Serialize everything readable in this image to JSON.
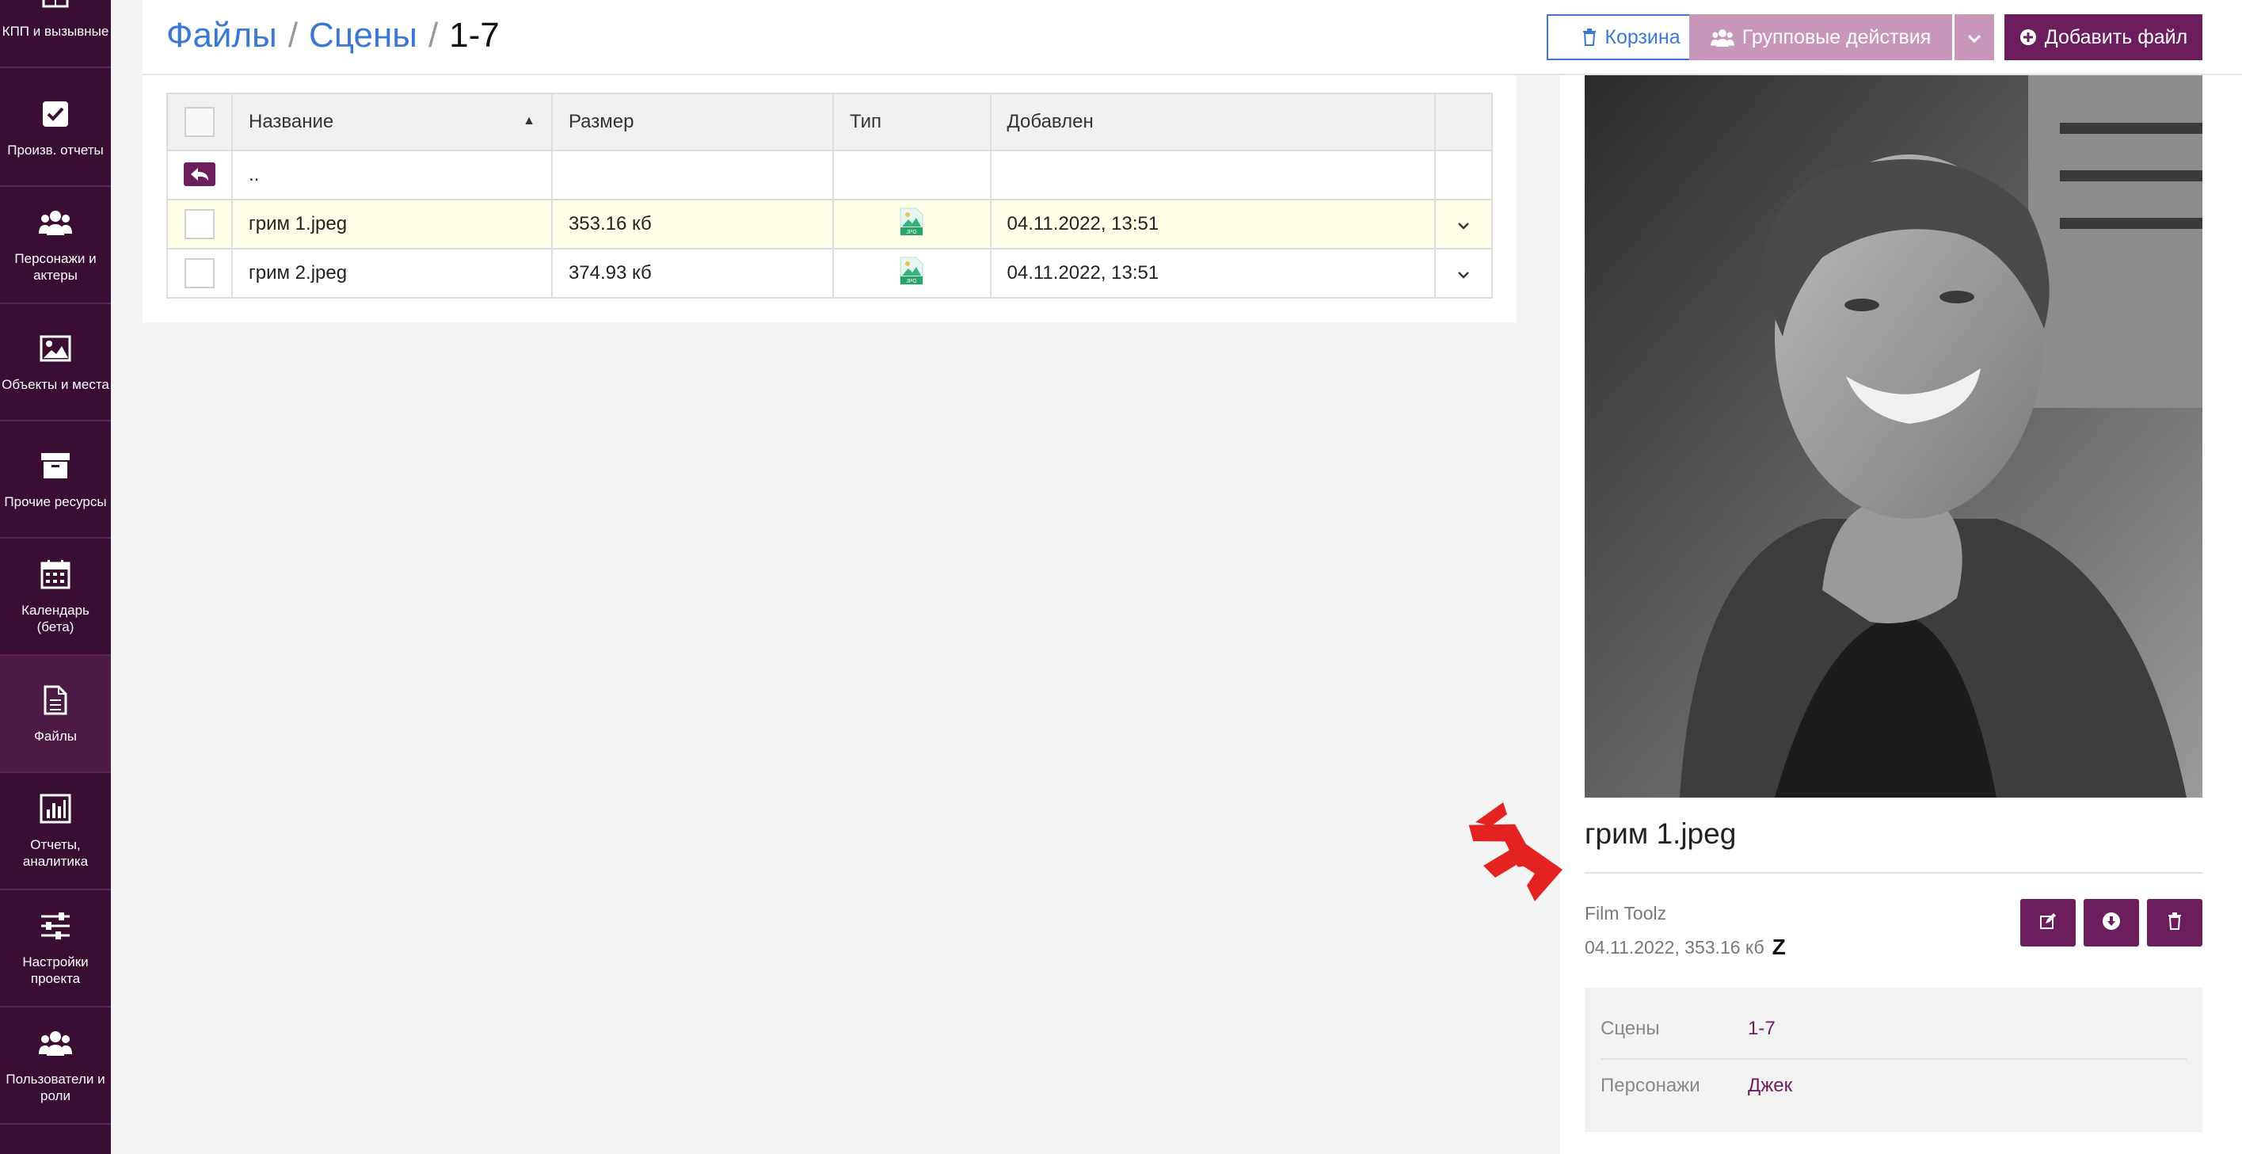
{
  "sidebar": {
    "items": [
      {
        "label": "КПП и вызывные",
        "icon": "table-icon"
      },
      {
        "label": "Произв. отчеты",
        "icon": "checkbox-icon"
      },
      {
        "label": "Персонажи и актеры",
        "icon": "users-icon"
      },
      {
        "label": "Объекты и места",
        "icon": "image-icon"
      },
      {
        "label": "Прочие ресурсы",
        "icon": "archive-icon"
      },
      {
        "label": "Календарь (бета)",
        "icon": "calendar-icon"
      },
      {
        "label": "Файлы",
        "icon": "file-icon",
        "active": true
      },
      {
        "label": "Отчеты, аналитика",
        "icon": "bar-chart-icon"
      },
      {
        "label": "Настройки проекта",
        "icon": "sliders-icon"
      },
      {
        "label": "Пользователи и роли",
        "icon": "users-icon"
      }
    ]
  },
  "header": {
    "breadcrumb": [
      "Файлы",
      "Сцены",
      "1-7"
    ],
    "trash_label": "Корзина",
    "group_actions_label": "Групповые действия",
    "add_file_label": "Добавить файл"
  },
  "table": {
    "columns": [
      "Название",
      "Размер",
      "Тип",
      "Добавлен"
    ],
    "parent_label": "..",
    "rows": [
      {
        "name": "грим 1.jpeg",
        "size": "353.16 кб",
        "type": "JPG",
        "added": "04.11.2022, 13:51",
        "selected": true
      },
      {
        "name": "грим 2.jpeg",
        "size": "374.93 кб",
        "type": "JPG",
        "added": "04.11.2022, 13:51",
        "selected": false
      }
    ]
  },
  "preview": {
    "title": "грим 1.jpeg",
    "owner": "Film Toolz",
    "meta": "04.11.2022, 353.16 кб",
    "logo_letter": "Z",
    "details": [
      {
        "key": "Сцены",
        "value": "1-7"
      },
      {
        "key": "Персонажи",
        "value": "Джек"
      }
    ]
  },
  "colors": {
    "sidebar_bg": "#3a0e33",
    "accent": "#6b1d5e",
    "link": "#3b78d4",
    "selected_row": "#fffee6",
    "arrow": "#e52222"
  }
}
